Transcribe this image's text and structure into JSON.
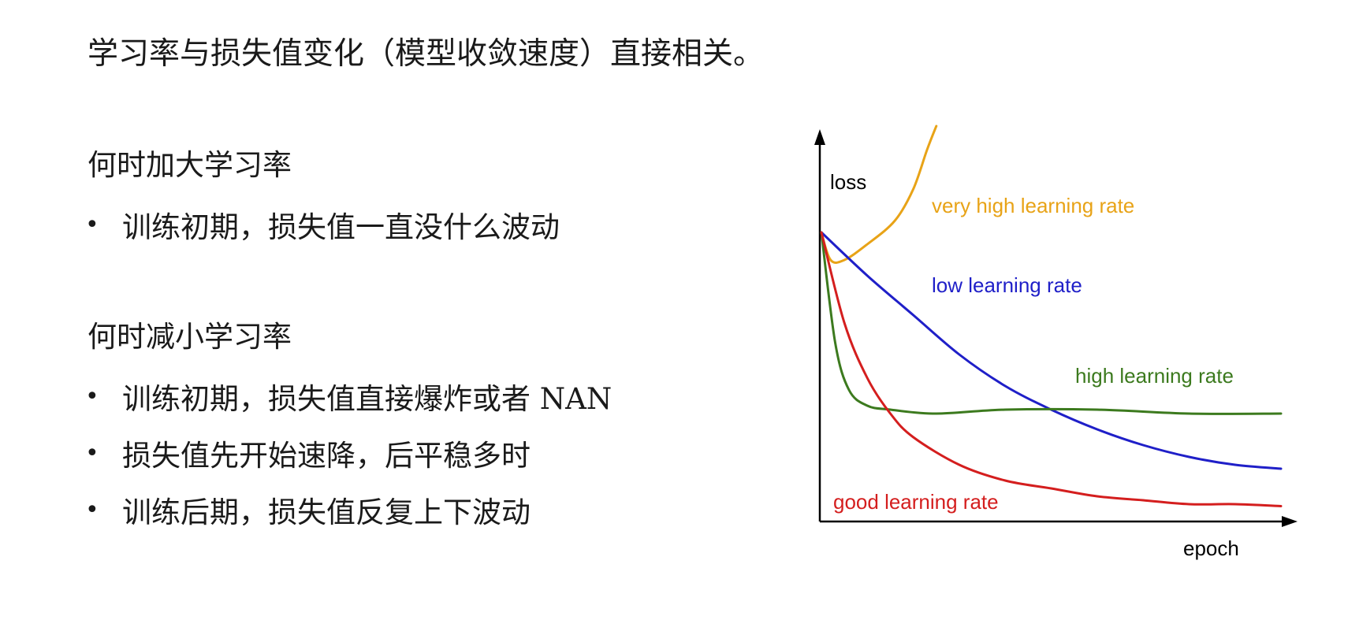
{
  "title": "学习率与损失值变化（模型收敛速度）直接相关。",
  "sections": [
    {
      "heading": "何时加大学习率",
      "items": [
        "训练初期，损失值一直没什么波动"
      ]
    },
    {
      "heading": "何时减小学习率",
      "items": [
        "训练初期，损失值直接爆炸或者 NAN",
        "损失值先开始速降，后平稳多时",
        "训练后期，损失值反复上下波动"
      ]
    }
  ],
  "bullet_glyph": "•",
  "chart_data": {
    "type": "line",
    "xlabel": "epoch",
    "ylabel": "loss",
    "x_ticks": false,
    "y_ticks": false,
    "grid": false,
    "series": [
      {
        "name": "very high learning rate",
        "color": "#e8a317",
        "x": [
          0,
          0.02,
          0.05,
          0.1,
          0.16,
          0.2,
          0.23,
          0.25
        ],
        "y": [
          0.73,
          0.66,
          0.66,
          0.7,
          0.76,
          0.84,
          0.94,
          1.0
        ]
      },
      {
        "name": "low learning rate",
        "color": "#1f1fc8",
        "x": [
          0,
          0.1,
          0.2,
          0.3,
          0.4,
          0.5,
          0.6,
          0.7,
          0.8,
          0.9,
          1.0
        ],
        "y": [
          0.73,
          0.62,
          0.52,
          0.42,
          0.34,
          0.28,
          0.23,
          0.19,
          0.16,
          0.14,
          0.13
        ]
      },
      {
        "name": "high learning rate",
        "color": "#3c7a1e",
        "x": [
          0,
          0.03,
          0.06,
          0.1,
          0.15,
          0.25,
          0.4,
          0.6,
          0.8,
          1.0
        ],
        "y": [
          0.73,
          0.45,
          0.33,
          0.29,
          0.28,
          0.27,
          0.28,
          0.28,
          0.27,
          0.27
        ]
      },
      {
        "name": "good learning rate",
        "color": "#d41e1e",
        "x": [
          0,
          0.05,
          0.1,
          0.15,
          0.2,
          0.3,
          0.4,
          0.5,
          0.6,
          0.7,
          0.8,
          0.9,
          1.0
        ],
        "y": [
          0.73,
          0.5,
          0.36,
          0.27,
          0.21,
          0.14,
          0.1,
          0.08,
          0.06,
          0.05,
          0.04,
          0.04,
          0.035
        ]
      }
    ]
  }
}
